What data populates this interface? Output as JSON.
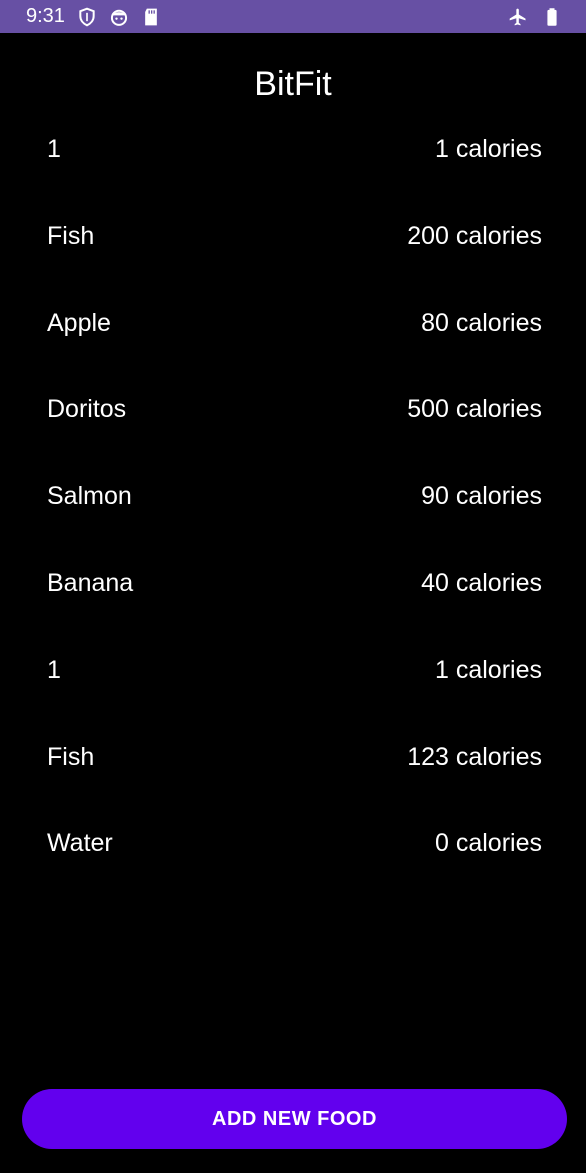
{
  "status_bar": {
    "time": "9:31",
    "color": "#6750a4",
    "left_icons": [
      "shield-icon",
      "face-icon",
      "sd-card-icon"
    ],
    "right_icons": [
      "airplane-icon",
      "battery-icon"
    ]
  },
  "app": {
    "title": "BitFit"
  },
  "foods": [
    {
      "name": "1",
      "calories": "1 calories"
    },
    {
      "name": "Fish",
      "calories": "200 calories"
    },
    {
      "name": "Apple",
      "calories": "80 calories"
    },
    {
      "name": "Doritos",
      "calories": "500 calories"
    },
    {
      "name": "Salmon",
      "calories": "90 calories"
    },
    {
      "name": "Banana",
      "calories": "40 calories"
    },
    {
      "name": "1",
      "calories": "1 calories"
    },
    {
      "name": "Fish",
      "calories": "123 calories"
    },
    {
      "name": "Water",
      "calories": "0 calories"
    }
  ],
  "actions": {
    "add_label": "ADD NEW FOOD",
    "button_color": "#6200ee"
  }
}
